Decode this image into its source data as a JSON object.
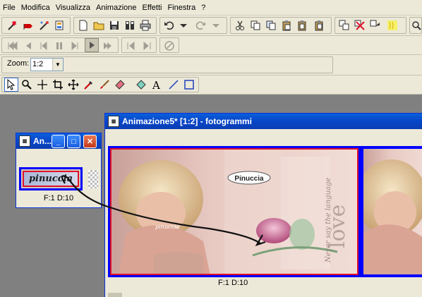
{
  "menu": {
    "items": [
      {
        "id": "file",
        "label": "File"
      },
      {
        "id": "modifica",
        "label": "Modifica"
      },
      {
        "id": "visualizza",
        "label": "Visualizza"
      },
      {
        "id": "animazione",
        "label": "Animazione"
      },
      {
        "id": "effetti",
        "label": "Effetti"
      },
      {
        "id": "finestra",
        "label": "Finestra"
      },
      {
        "id": "help",
        "label": "?"
      }
    ]
  },
  "zoom": {
    "label": "Zoom:",
    "value": "1:2"
  },
  "small_window": {
    "title": "An...",
    "frame_text": "pinuccia",
    "status": "F:1  D:10"
  },
  "main_window": {
    "title": "Animazione5* [1:2] - fotogrammi",
    "status": "F:1  D:10",
    "frame_label": "Pinuccia",
    "frame_signature": "pinuccia",
    "frame_vertical_text": "Never say the language",
    "frame_love_text": "love"
  },
  "colors": {
    "title_blue": "#0846c8",
    "frame_blue": "#0000ff",
    "frame_red": "#e0102a"
  }
}
